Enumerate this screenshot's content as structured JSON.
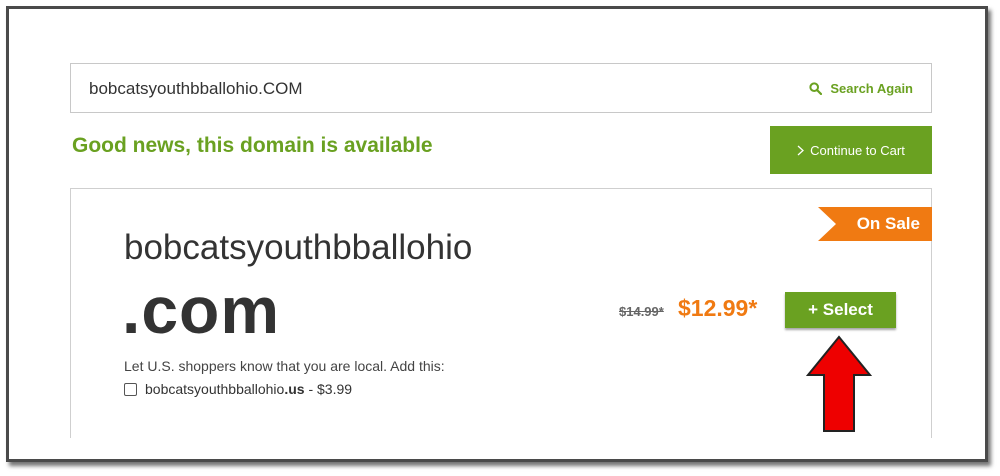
{
  "search": {
    "value": "bobcatsyouthbballohio.COM",
    "search_again_label": "Search Again"
  },
  "status": {
    "message": "Good news, this domain is available"
  },
  "cart": {
    "continue_label": "Continue to Cart"
  },
  "result": {
    "badge": "On Sale",
    "domain_name": "bobcatsyouthbballohio",
    "tld": ".com",
    "original_price": "$14.99*",
    "sale_price": "$12.99*",
    "select_label": "+ Select",
    "local_prompt": "Let U.S. shoppers know that you are local. Add this:",
    "addon_domain": "bobcatsyouthbballohio",
    "addon_tld": ".us",
    "addon_price": " - $3.99"
  },
  "colors": {
    "brand_green": "#6aa121",
    "sale_orange": "#f07a12",
    "arrow_red": "#ee0000"
  },
  "icons": {
    "search": "search-icon",
    "chevron": "chevron-right-icon",
    "arrow": "red-arrow-up-icon"
  }
}
